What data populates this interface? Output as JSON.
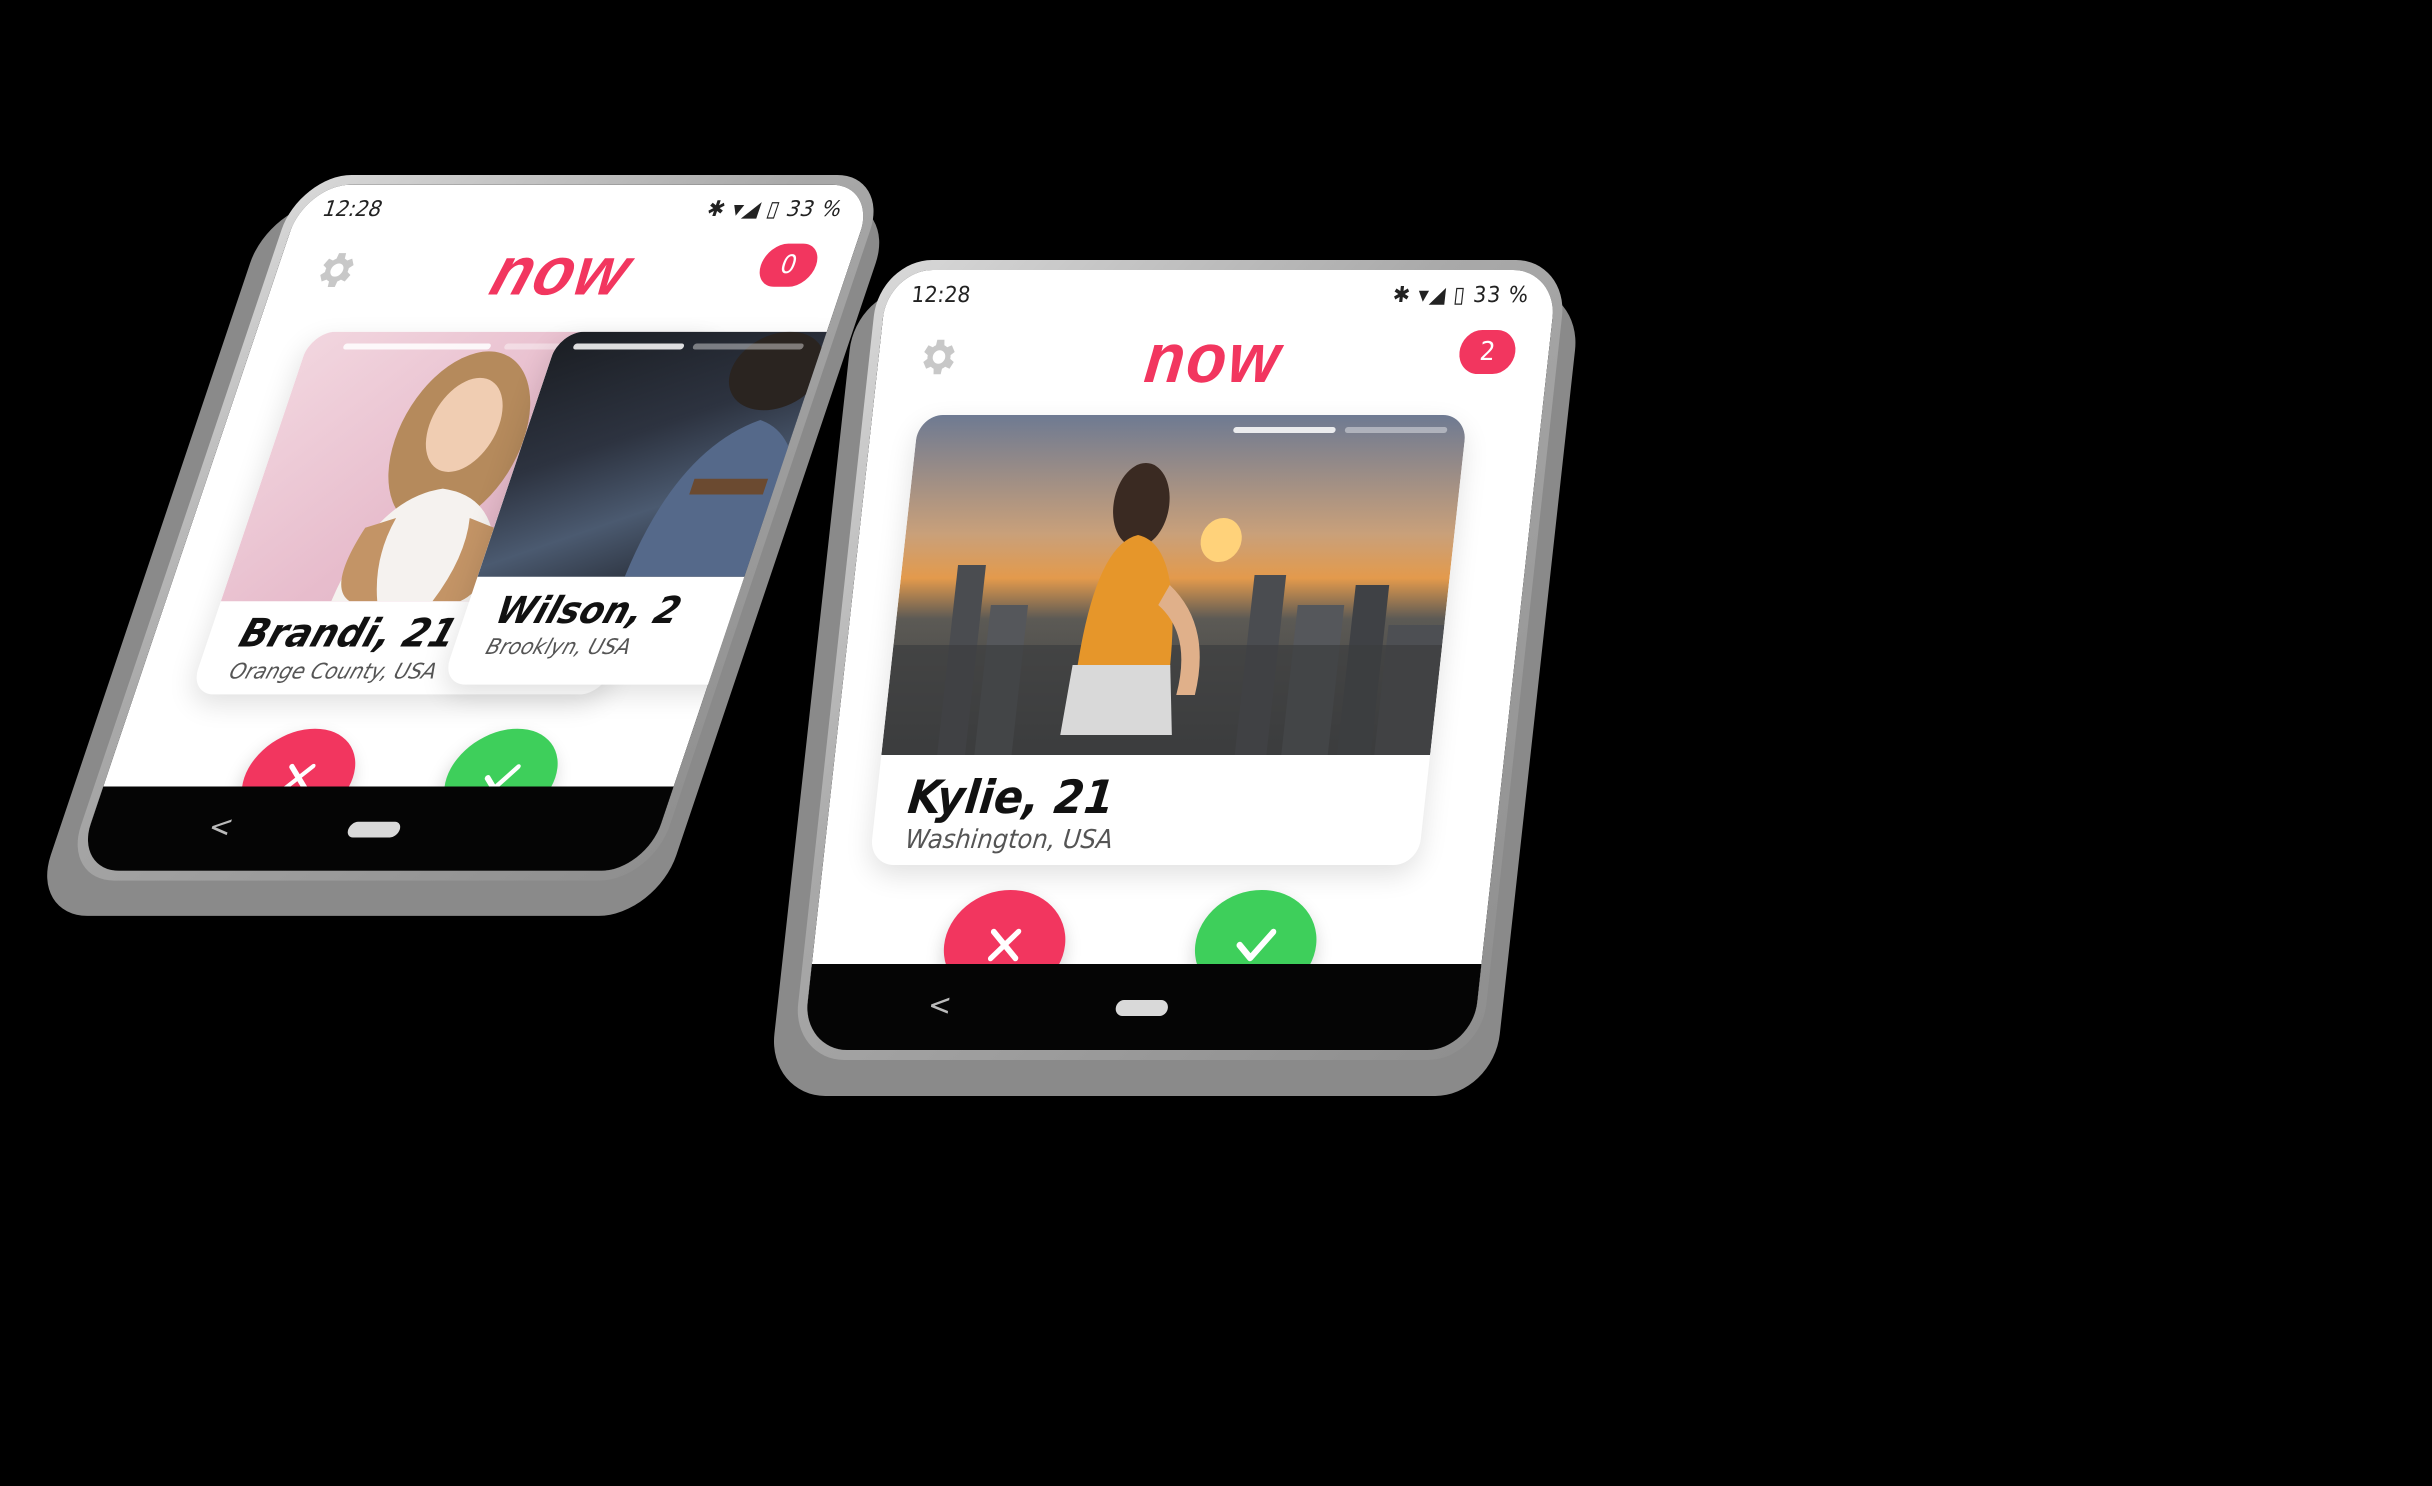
{
  "app": {
    "logo": "now"
  },
  "phones": [
    {
      "status": {
        "time": "12:28",
        "icons": "✱ ▾◢ ▯ 33 %"
      },
      "badge": "0",
      "cards": [
        {
          "name": "Brandi, 21",
          "location": "Orange County, USA"
        },
        {
          "name": "Wilson, 2",
          "location": "Brooklyn, USA"
        }
      ],
      "nav": {
        "back": "<"
      }
    },
    {
      "status": {
        "time": "12:28",
        "icons": "✱ ▾◢ ▯ 33 %"
      },
      "badge": "2",
      "cards": [
        {
          "name": "Kylie, 21",
          "location": "Washington, USA"
        }
      ],
      "nav": {
        "back": "<"
      }
    }
  ],
  "colors": {
    "brand": "#f2365f",
    "accept": "#3ecf5b",
    "reject": "#f2365f"
  },
  "icons": {
    "settings": "gear-icon",
    "reject": "close-icon",
    "accept": "check-icon"
  }
}
